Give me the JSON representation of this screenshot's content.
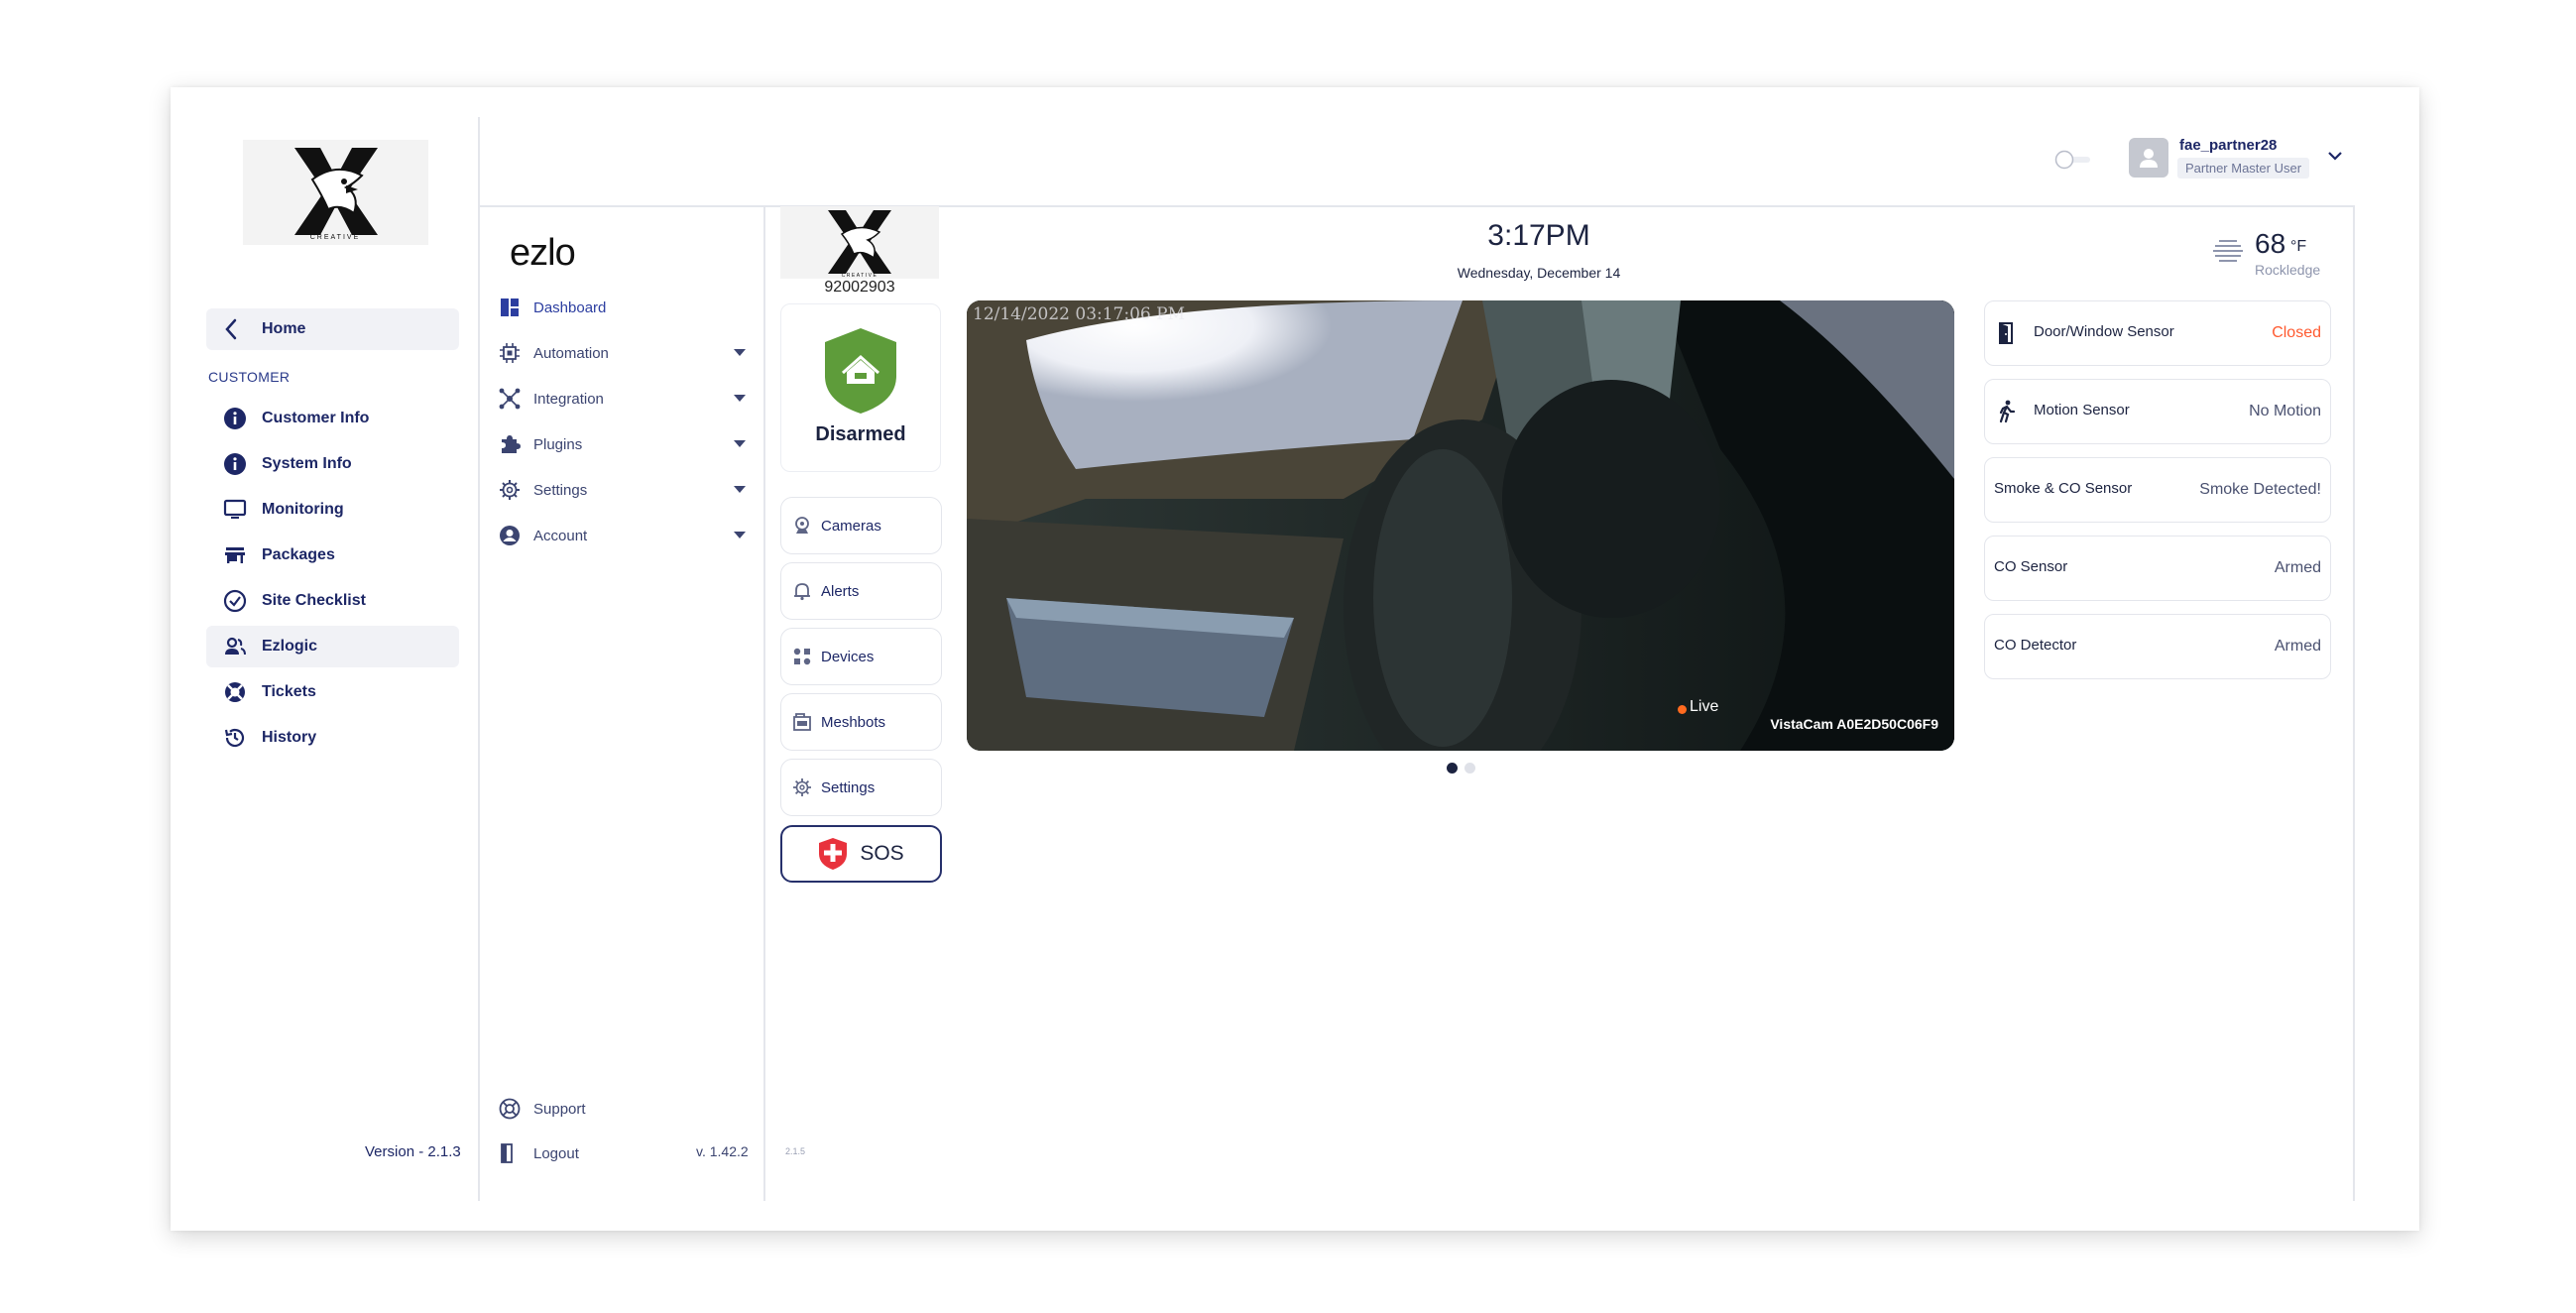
{
  "brand": {
    "partner_logo_text": "CREATIVE",
    "ezlo_logo": "ezlo"
  },
  "sidebar": {
    "home_label": "Home",
    "section_label": "CUSTOMER",
    "items": [
      {
        "label": "Customer Info",
        "icon": "info-icon"
      },
      {
        "label": "System Info",
        "icon": "info-icon"
      },
      {
        "label": "Monitoring",
        "icon": "monitor-icon"
      },
      {
        "label": "Packages",
        "icon": "store-icon"
      },
      {
        "label": "Site Checklist",
        "icon": "check-circle-icon"
      },
      {
        "label": "Ezlogic",
        "icon": "users-icon"
      },
      {
        "label": "Tickets",
        "icon": "lifebuoy-icon"
      },
      {
        "label": "History",
        "icon": "history-icon"
      }
    ],
    "active_item": "Ezlogic",
    "version": "Version - 2.1.3"
  },
  "ezlo_nav": {
    "items": [
      {
        "label": "Dashboard",
        "icon": "dashboard-icon"
      },
      {
        "label": "Automation",
        "icon": "chip-icon"
      },
      {
        "label": "Integration",
        "icon": "integration-icon"
      },
      {
        "label": "Plugins",
        "icon": "puzzle-icon"
      },
      {
        "label": "Settings",
        "icon": "gear-icon"
      },
      {
        "label": "Account",
        "icon": "account-icon"
      }
    ],
    "footer": {
      "support_label": "Support",
      "logout_label": "Logout",
      "version": "v. 1.42.2"
    }
  },
  "user": {
    "name": "fae_partner28",
    "role": "Partner Master User"
  },
  "device": {
    "id": "92002903",
    "status": "Disarmed",
    "buttons": [
      "Cameras",
      "Alerts",
      "Devices",
      "Meshbots",
      "Settings"
    ],
    "sos_label": "SOS",
    "mini_version": "2.1.5"
  },
  "header": {
    "time": "3:17PM",
    "date": "Wednesday, December 14",
    "temperature": "68",
    "unit": "°F",
    "city": "Rockledge"
  },
  "camera": {
    "timestamp": "12/14/2022 03:17:06 PM",
    "live_label": "Live",
    "name": "VistaCam A0E2D50C06F9",
    "slide_count": 2,
    "active_slide": 1
  },
  "sensors": [
    {
      "name": "Door/Window Sensor",
      "state": "Closed",
      "alert": true,
      "icon": "door-icon"
    },
    {
      "name": "Motion Sensor",
      "state": "No Motion",
      "alert": false,
      "icon": "walking-icon"
    },
    {
      "name": "Smoke & CO Sensor",
      "state": "Smoke Detected!",
      "alert": false,
      "icon": ""
    },
    {
      "name": "CO Sensor",
      "state": "Armed",
      "alert": false,
      "icon": ""
    },
    {
      "name": "CO Detector",
      "state": "Armed",
      "alert": false,
      "icon": ""
    }
  ],
  "colors": {
    "navy": "#1d2766",
    "accent_blue": "#2c3ea0",
    "armed_green": "#5e9c3a",
    "alert_orange": "#ff5a30",
    "sos_red": "#e8323c"
  }
}
